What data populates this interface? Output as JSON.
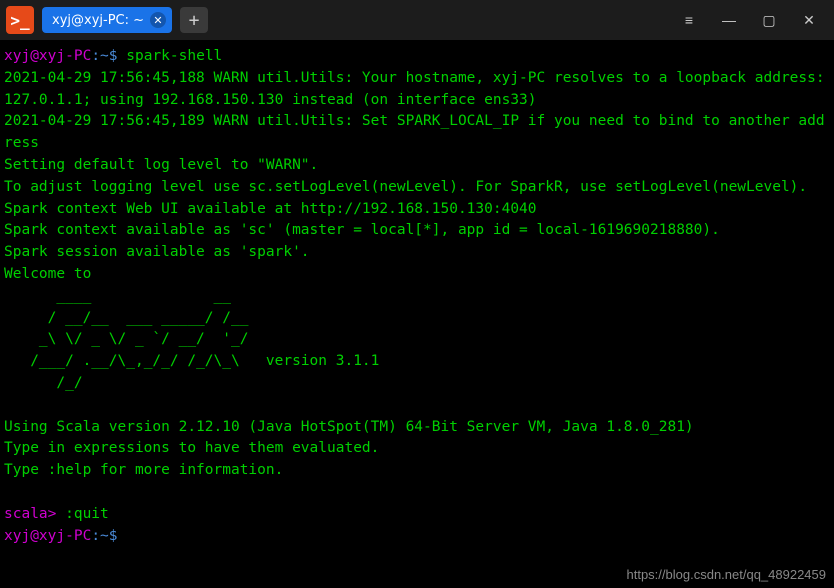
{
  "titlebar": {
    "tab_title": "xyj@xyj-PC: ~",
    "app_glyph": ">_"
  },
  "prompt1": {
    "user": "xyj@xyj-PC",
    "colon": ":",
    "path": "~",
    "dollar": "$ ",
    "cmd": "spark-shell"
  },
  "output": {
    "l1": "2021-04-29 17:56:45,188 WARN util.Utils: Your hostname, xyj-PC resolves to a loopback address: 127.0.1.1; using 192.168.150.130 instead (on interface ens33)",
    "l2": "2021-04-29 17:56:45,189 WARN util.Utils: Set SPARK_LOCAL_IP if you need to bind to another address",
    "l3": "Setting default log level to \"WARN\".",
    "l4": "To adjust logging level use sc.setLogLevel(newLevel). For SparkR, use setLogLevel(newLevel).",
    "l5": "Spark context Web UI available at http://192.168.150.130:4040",
    "l6": "Spark context available as 'sc' (master = local[*], app id = local-1619690218880).",
    "l7": "Spark session available as 'spark'.",
    "l8": "Welcome to",
    "art1": "      ____              __",
    "art2": "     / __/__  ___ _____/ /__",
    "art3": "    _\\ \\/ _ \\/ _ `/ __/  '_/",
    "art4": "   /___/ .__/\\_,_/_/ /_/\\_\\   version 3.1.1",
    "art5": "      /_/",
    "blank": "",
    "l9": "Using Scala version 2.12.10 (Java HotSpot(TM) 64-Bit Server VM, Java 1.8.0_281)",
    "l10": "Type in expressions to have them evaluated.",
    "l11": "Type :help for more information."
  },
  "scala": {
    "prompt": "scala> ",
    "cmd": ":quit"
  },
  "prompt2": {
    "user": "xyj@xyj-PC",
    "colon": ":",
    "path": "~",
    "dollar": "$ "
  },
  "watermark": "https://blog.csdn.net/qq_48922459"
}
